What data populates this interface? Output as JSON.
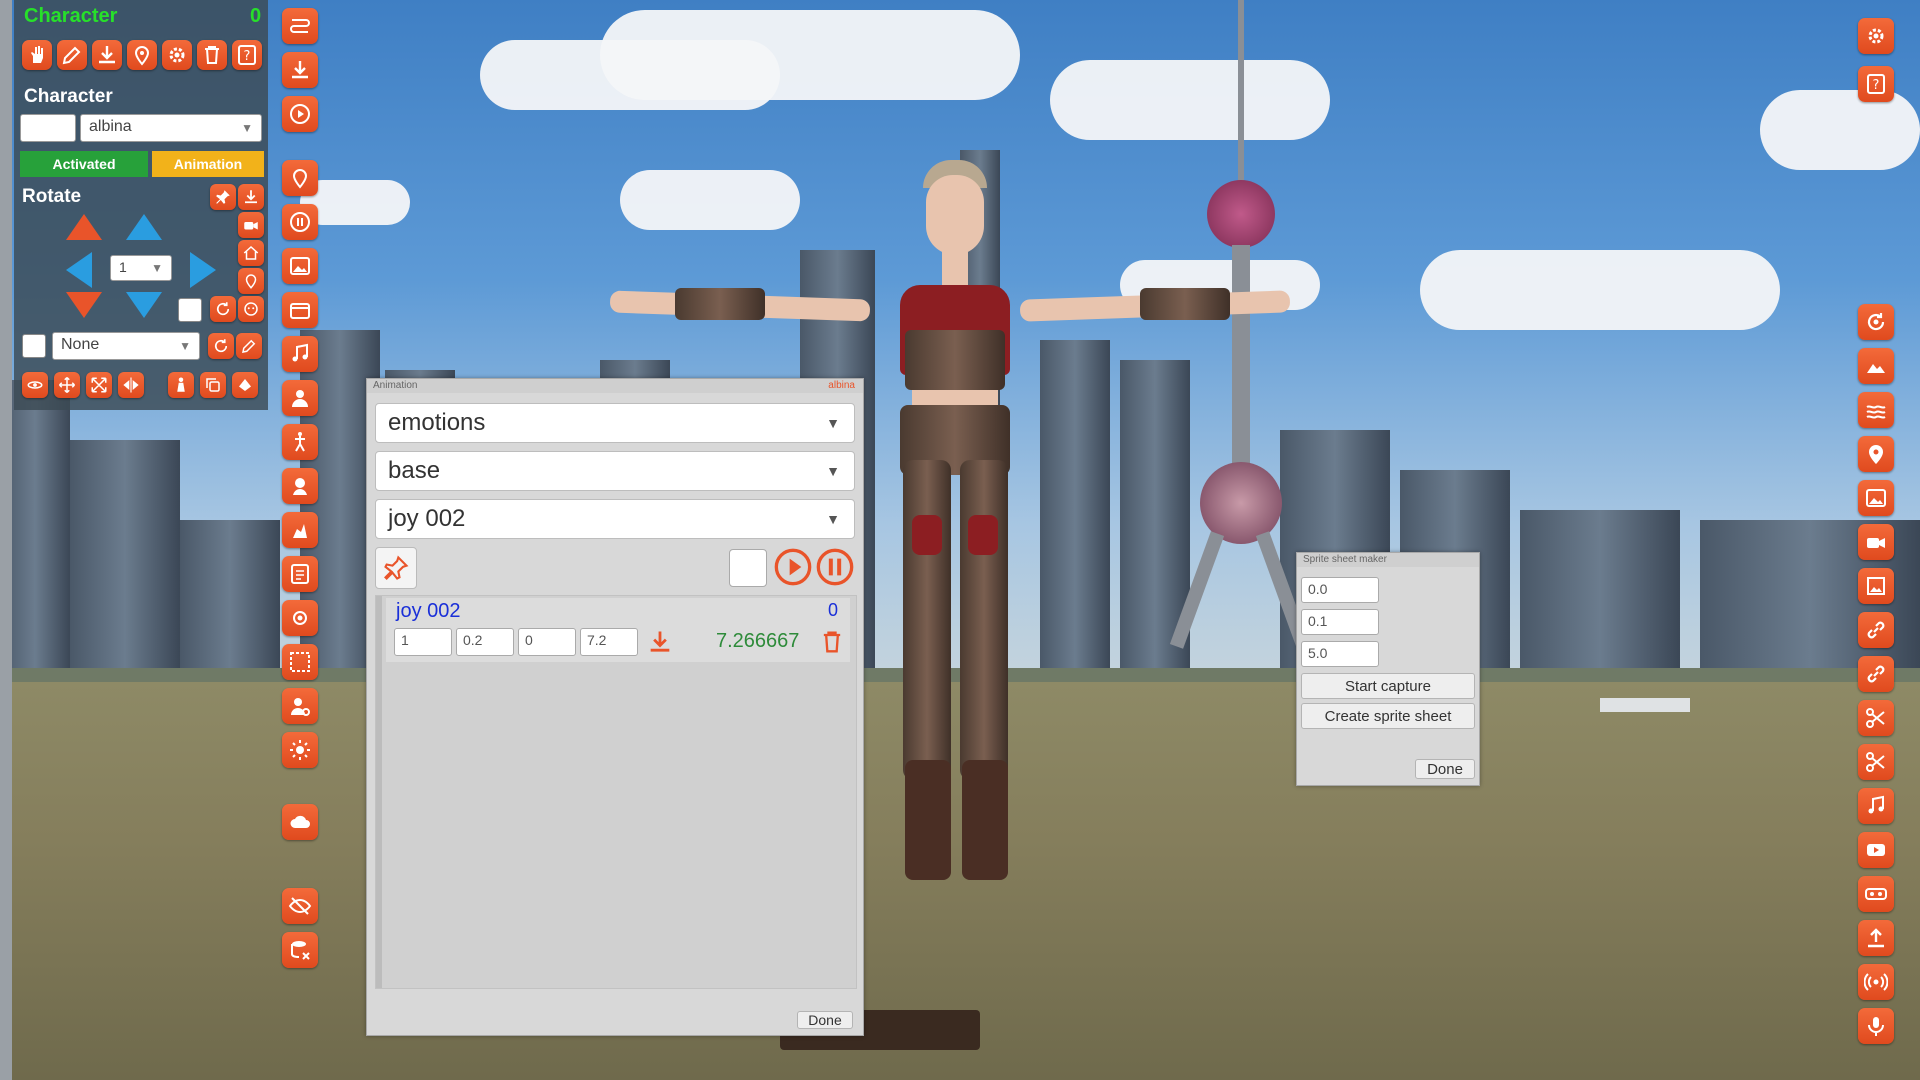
{
  "colors": {
    "accent_orange": "#E9542A",
    "activated_green": "#27A13A",
    "animation_yellow": "#F2B21A",
    "title_green": "#27E02A",
    "link_blue": "#1A2FD8",
    "duration_green": "#2E8B3A"
  },
  "left_panel": {
    "title": "Character",
    "count": "0",
    "toolbar_icons": [
      "hand-icon",
      "edit-icon",
      "download-icon",
      "location-icon",
      "gear-icon",
      "trash-icon",
      "help-icon"
    ],
    "character_label": "Character",
    "character_input": "",
    "character_select": "albina",
    "activated_label": "Activated",
    "animation_label": "Animation",
    "rotate_label": "Rotate",
    "rotate_step": "1",
    "pose_select": "None"
  },
  "animation_dialog": {
    "header": "Animation",
    "header_right": "albina",
    "category_select": "emotions",
    "subcategory_select": "base",
    "animation_select": "joy 002",
    "item": {
      "name": "joy 002",
      "index": "0",
      "fields": [
        "1",
        "0.2",
        "0",
        "7.2"
      ],
      "duration": "7.266667"
    },
    "done_label": "Done"
  },
  "sprite_dialog": {
    "header": "Sprite sheet maker",
    "fields": [
      "0.0",
      "0.1",
      "5.0"
    ],
    "start_capture_label": "Start capture",
    "create_sprite_label": "Create sprite sheet",
    "done_label": "Done"
  },
  "tool_column_icons": [
    "path-icon",
    "download-icon",
    "play-icon",
    "location-icon",
    "pause-icon",
    "image-icon",
    "film-icon",
    "music-mp3-icon",
    "person-icon",
    "pose-icon",
    "head-icon",
    "dance-icon",
    "text-icon",
    "camera-icon",
    "frame-icon",
    "user-settings-icon",
    "sun-icon",
    "cloud-icon",
    "hide-icon",
    "database-delete-icon"
  ],
  "right_column_icons": [
    "gear-icon",
    "help-icon",
    "rotate-camera-icon",
    "landscape-icon",
    "water-icon",
    "map-pin-icon",
    "photo-icon",
    "video-camera-icon",
    "picture-icon",
    "link-icon",
    "link-icon",
    "scissors-icon",
    "scissors-icon",
    "music-mp3-icon",
    "youtube-icon",
    "vr-icon",
    "upload-icon",
    "broadcast-icon",
    "microphone-icon"
  ]
}
